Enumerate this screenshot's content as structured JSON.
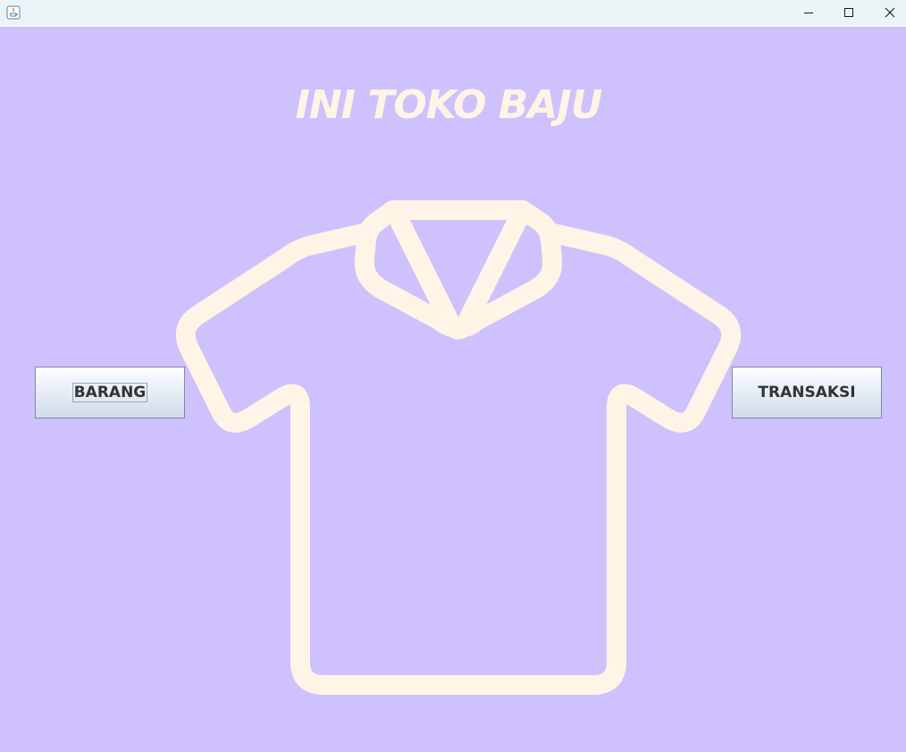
{
  "window": {
    "title": "",
    "controls": {
      "minimize_icon": "minimize-icon",
      "maximize_icon": "maximize-icon",
      "close_icon": "close-icon"
    }
  },
  "main": {
    "heading": "INI TOKO BAJU",
    "illustration_icon": "tshirt-icon",
    "buttons": {
      "barang_label": "BARANG",
      "transaksi_label": "TRANSAKSI"
    }
  },
  "colors": {
    "background": "#cfc1fd",
    "heading": "#fff4e6",
    "shirt_outline": "#fff4e6",
    "titlebar": "#eaf4f6"
  }
}
